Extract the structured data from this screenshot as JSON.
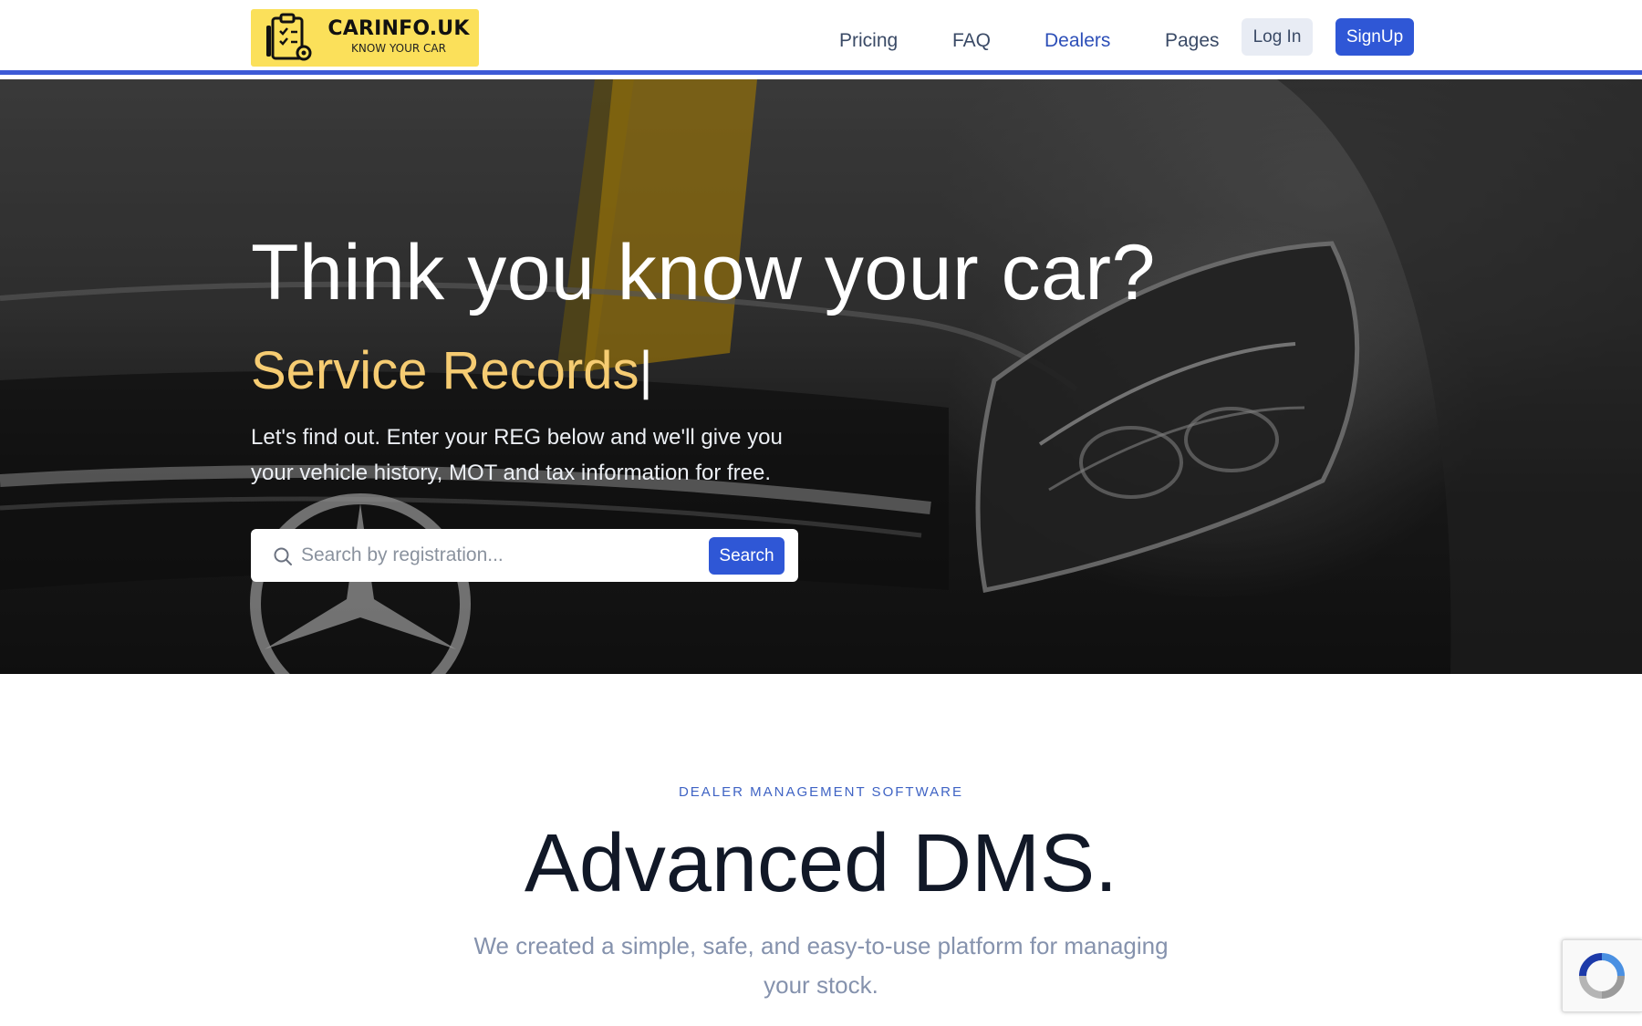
{
  "brand": {
    "name": "CARINFO.UK",
    "tagline": "KNOW YOUR CAR",
    "accent": "#fbe05a",
    "primary": "#2f57d6"
  },
  "nav": {
    "links": [
      {
        "label": "Pricing"
      },
      {
        "label": "FAQ"
      },
      {
        "label": "Dealers"
      },
      {
        "label": "Pages"
      }
    ],
    "login_label": "Log In",
    "signup_label": "SignUp"
  },
  "hero": {
    "title": "Think you know your car?",
    "typed_text": "Service Records",
    "caret": "|",
    "description": "Let's find out. Enter your REG below and we'll give you your vehicle history, MOT and tax information for free.",
    "search": {
      "placeholder": "Search by registration...",
      "button_label": "Search",
      "icon": "search-icon"
    }
  },
  "dms": {
    "eyebrow": "DEALER MANAGEMENT SOFTWARE",
    "title": "Advanced DMS.",
    "description": "We created a simple, safe, and easy-to-use platform for managing your stock."
  },
  "recaptcha": {
    "icon": "recaptcha-icon"
  }
}
